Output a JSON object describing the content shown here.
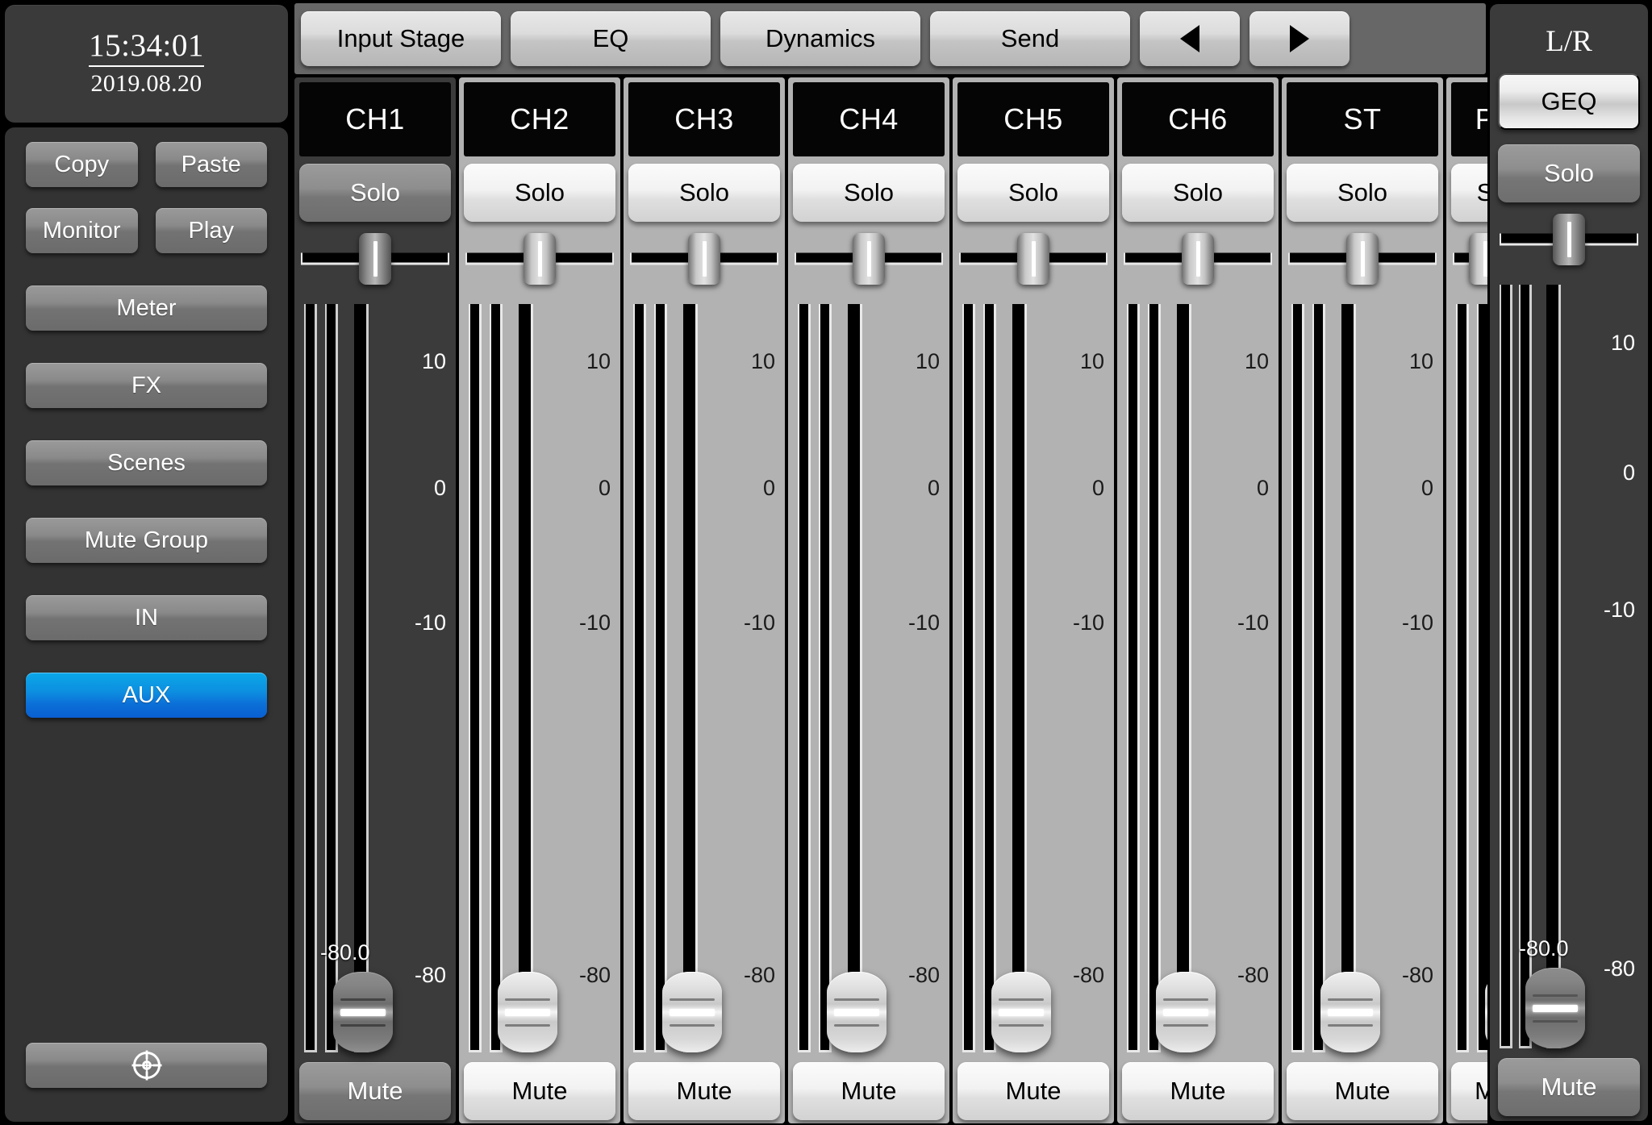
{
  "sidebar": {
    "clock": {
      "time": "15:34:01",
      "date": "2019.08.20"
    },
    "buttons": {
      "copy": "Copy",
      "paste": "Paste",
      "monitor": "Monitor",
      "play": "Play",
      "meter": "Meter",
      "fx": "FX",
      "scenes": "Scenes",
      "mute_group": "Mute Group",
      "in": "IN",
      "aux": "AUX"
    },
    "settings_icon": "gear-icon",
    "active_button": "AUX",
    "active_color": "#0d8fe0"
  },
  "tabbar": {
    "tabs": [
      {
        "label": "Input Stage"
      },
      {
        "label": "EQ"
      },
      {
        "label": "Dynamics"
      },
      {
        "label": "Send"
      }
    ],
    "prev_icon": "chevron-left-icon",
    "next_icon": "chevron-right-icon"
  },
  "channels": [
    {
      "name": "CH1",
      "solo": "Solo",
      "mute": "Mute",
      "selected": true,
      "fader_value": "-80.0",
      "pan": 50,
      "scale": [
        "10",
        "0",
        "-10",
        "-80"
      ],
      "clipped": false
    },
    {
      "name": "CH2",
      "solo": "Solo",
      "mute": "Mute",
      "selected": false,
      "fader_value": "",
      "pan": 50,
      "scale": [
        "10",
        "0",
        "-10",
        "-80"
      ],
      "clipped": false
    },
    {
      "name": "CH3",
      "solo": "Solo",
      "mute": "Mute",
      "selected": false,
      "fader_value": "",
      "pan": 50,
      "scale": [
        "10",
        "0",
        "-10",
        "-80"
      ],
      "clipped": false
    },
    {
      "name": "CH4",
      "solo": "Solo",
      "mute": "Mute",
      "selected": false,
      "fader_value": "",
      "pan": 50,
      "scale": [
        "10",
        "0",
        "-10",
        "-80"
      ],
      "clipped": false
    },
    {
      "name": "CH5",
      "solo": "Solo",
      "mute": "Mute",
      "selected": false,
      "fader_value": "",
      "pan": 50,
      "scale": [
        "10",
        "0",
        "-10",
        "-80"
      ],
      "clipped": false
    },
    {
      "name": "CH6",
      "solo": "Solo",
      "mute": "Mute",
      "selected": false,
      "fader_value": "",
      "pan": 50,
      "scale": [
        "10",
        "0",
        "-10",
        "-80"
      ],
      "clipped": false
    },
    {
      "name": "ST",
      "solo": "Solo",
      "mute": "Mute",
      "selected": false,
      "fader_value": "",
      "pan": 50,
      "scale": [
        "10",
        "0",
        "-10",
        "-80"
      ],
      "clipped": false
    },
    {
      "name": "P",
      "solo": "S",
      "mute": "M",
      "selected": false,
      "fader_value": "",
      "pan": 50,
      "scale": [],
      "clipped": true
    }
  ],
  "master": {
    "title": "L/R",
    "geq": "GEQ",
    "solo": "Solo",
    "mute": "Mute",
    "fader_value": "-80.0",
    "scale": [
      "10",
      "0",
      "-10",
      "-80"
    ]
  }
}
